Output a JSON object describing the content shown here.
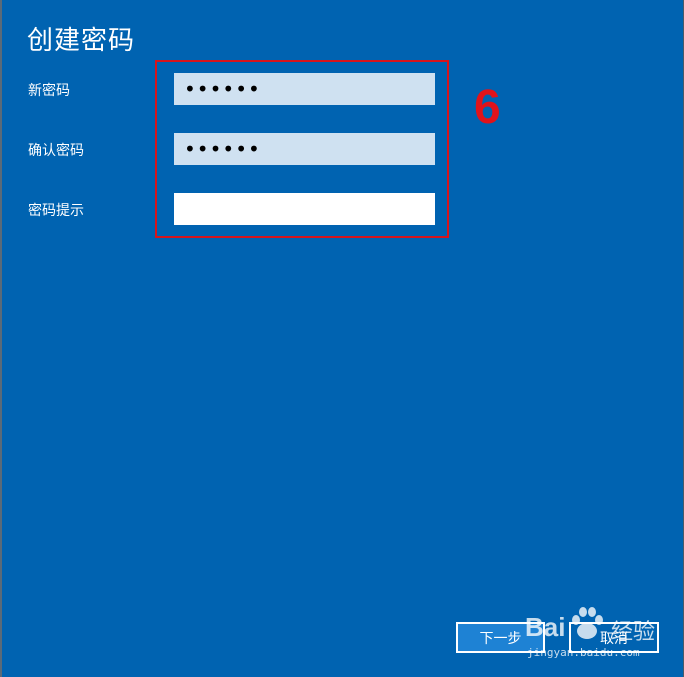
{
  "dialog": {
    "title": "创建密码",
    "fields": [
      {
        "label": "新密码",
        "value": "••••••"
      },
      {
        "label": "确认密码",
        "value": "••••••"
      },
      {
        "label": "密码提示",
        "value": ""
      }
    ],
    "buttons": {
      "next_label": "下一步",
      "cancel_label": "取消"
    }
  },
  "annotation": {
    "step_number": "6",
    "color": "#e0131b"
  },
  "watermark": {
    "brand": "Bai",
    "brand_cn": "经验",
    "url": "jingyan.baidu.com"
  },
  "colors": {
    "background": "#0063b1",
    "input_filled": "#cfe1f1",
    "button_primary": "#1e82d4"
  }
}
